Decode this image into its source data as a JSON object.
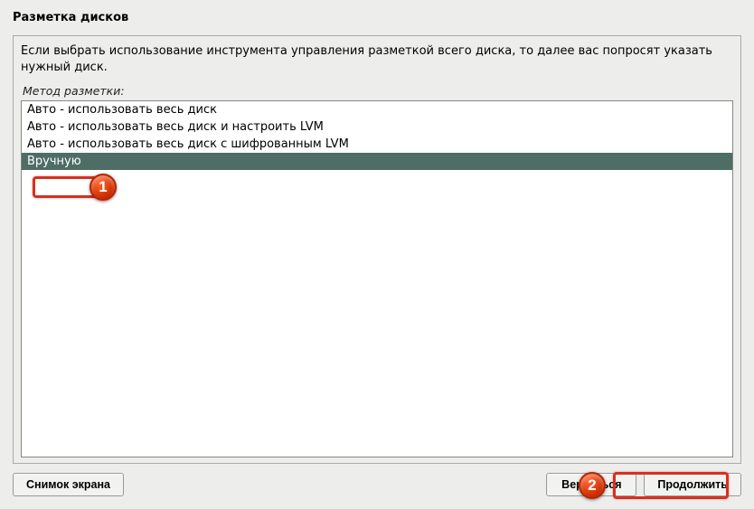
{
  "title": "Разметка дисков",
  "instruction": "Если выбрать использование инструмента управления разметкой всего диска, то далее вас попросят указать нужный диск.",
  "method_label": "Метод разметки:",
  "options": [
    "Авто - использовать весь диск",
    "Авто - использовать весь диск и настроить LVM",
    "Авто - использовать весь диск с шифрованным LVM",
    "Вручную"
  ],
  "buttons": {
    "screenshot": "Снимок экрана",
    "back": "Вернуться",
    "continue": "Продолжить"
  },
  "markers": {
    "one": "1",
    "two": "2"
  }
}
